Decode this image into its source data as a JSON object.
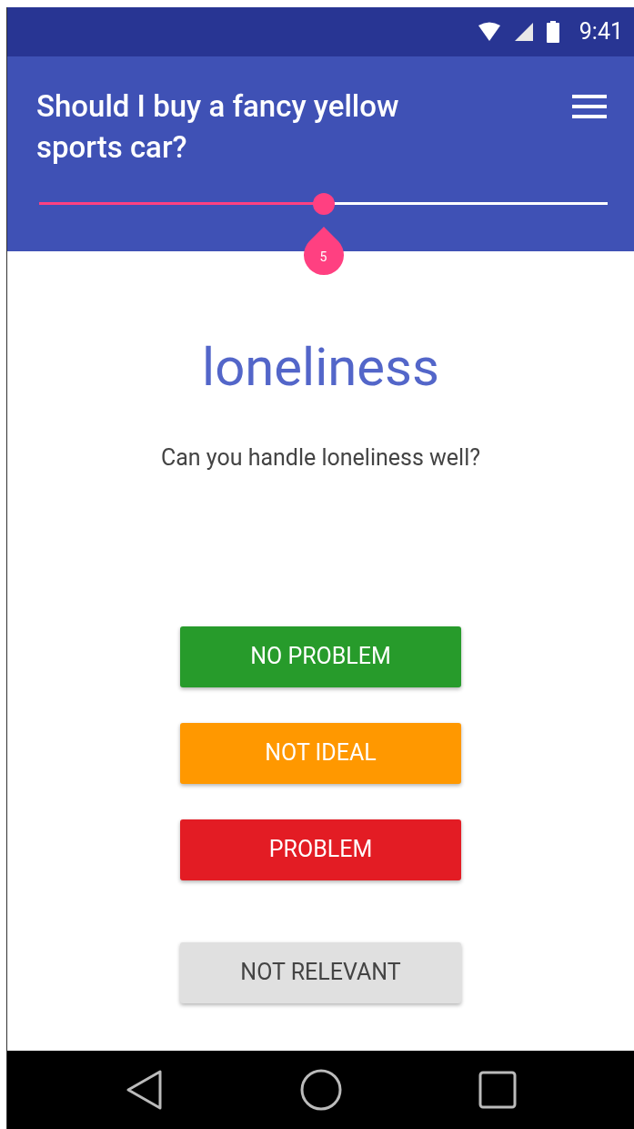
{
  "status_bar": {
    "time": "9:41"
  },
  "app_bar": {
    "title": "Should I buy a fancy yellow sports car?"
  },
  "slider": {
    "level": 0.5,
    "value_label": "5"
  },
  "topic": {
    "title": "loneliness",
    "question": "Can you handle loneliness well?"
  },
  "answers": [
    {
      "label": "NO PROBLEM",
      "kind": "answer",
      "color": "#279b2b"
    },
    {
      "label": "NOT IDEAL",
      "kind": "answer",
      "color": "#ff9800"
    },
    {
      "label": "PROBLEM",
      "kind": "answer",
      "color": "#e31c24"
    },
    {
      "label": "NOT RELEVANT",
      "kind": "skip",
      "color": "#e0e0e0"
    }
  ]
}
